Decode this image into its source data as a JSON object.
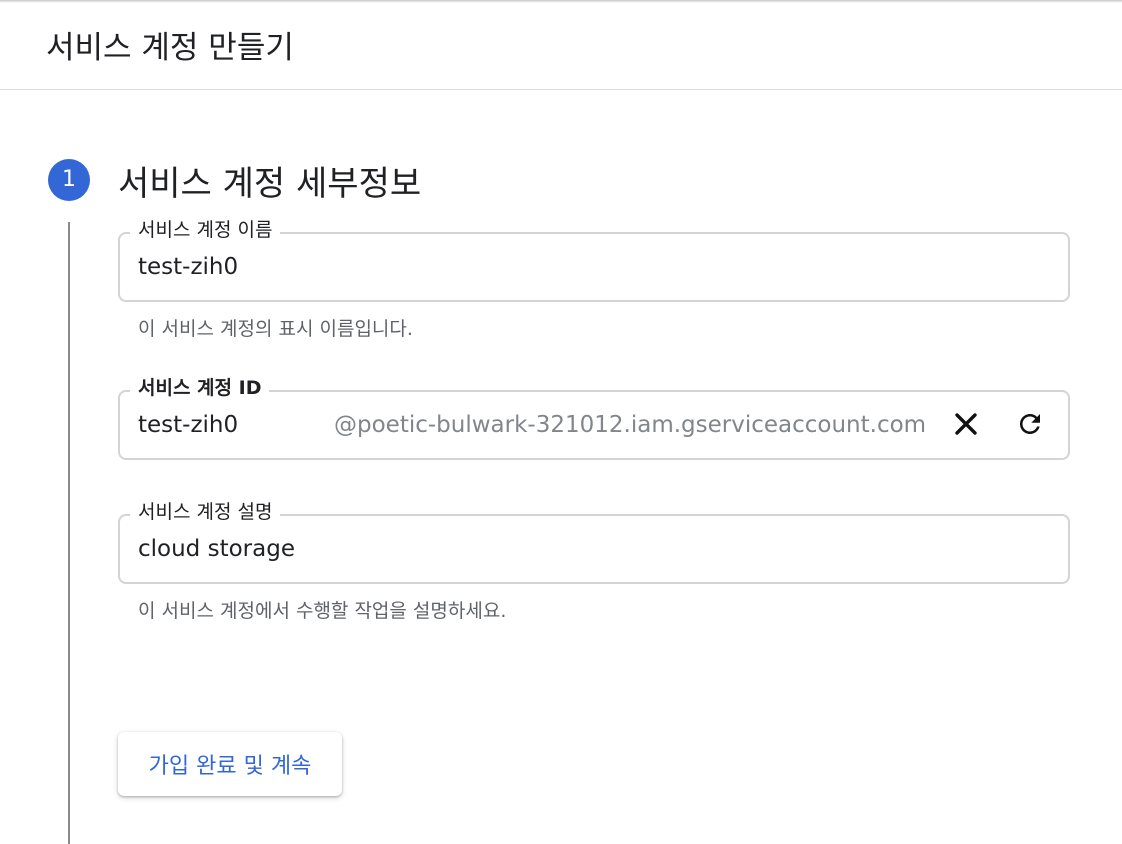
{
  "header": {
    "title": "서비스 계정 만들기"
  },
  "step": {
    "number": "1",
    "title": "서비스 계정 세부정보"
  },
  "fields": {
    "name": {
      "label": "서비스 계정 이름",
      "value": "test-zih0",
      "helper": "이 서비스 계정의 표시 이름입니다."
    },
    "id": {
      "label": "서비스 계정 ID",
      "value": "test-zih0",
      "suffix": "@poetic-bulwark-321012.iam.gserviceaccount.com",
      "icons": [
        "close-icon",
        "refresh-icon"
      ]
    },
    "description": {
      "label": "서비스 계정 설명",
      "value": "cloud storage",
      "helper": "이 서비스 계정에서 수행할 작업을 설명하세요."
    }
  },
  "actions": {
    "submit_label": "가입 완료 및 계속"
  },
  "colors": {
    "accent": "#3367d6",
    "border": "#d3d4d6",
    "helper_text": "#5f6368",
    "suffix_text": "#80868b"
  }
}
